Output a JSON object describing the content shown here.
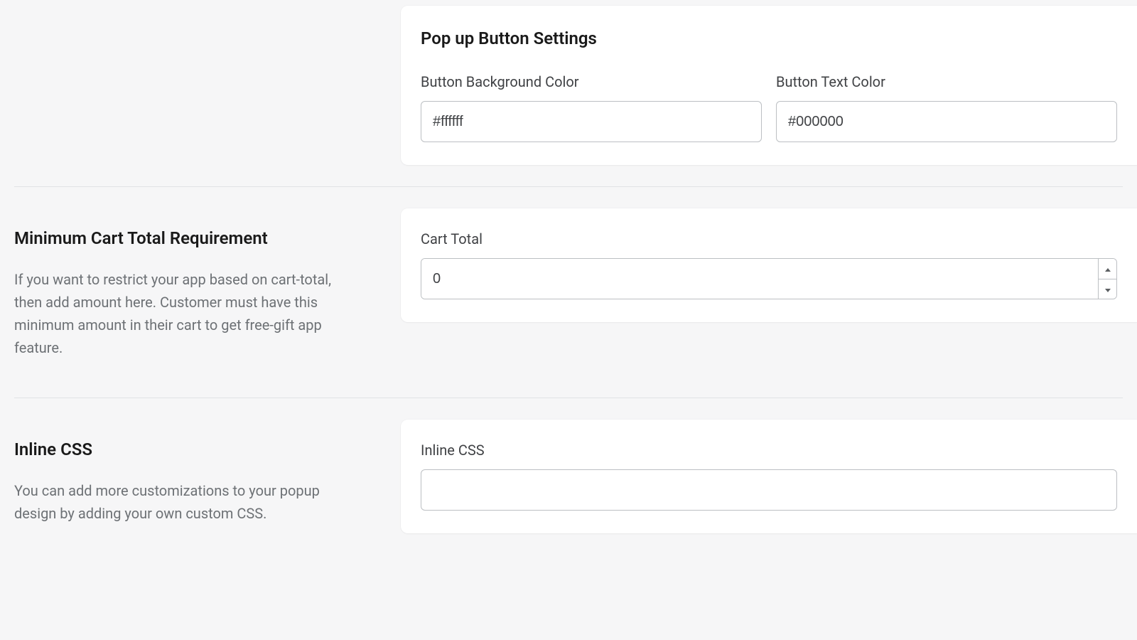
{
  "popup_button": {
    "title": "Pop up Button Settings",
    "bg_label": "Button Background Color",
    "bg_value": "#ffffff",
    "text_label": "Button Text Color",
    "text_value": "#000000"
  },
  "min_cart": {
    "title": "Minimum Cart Total Requirement",
    "description": "If you want to restrict your app based on cart-total, then add amount here. Customer must have this minimum amount in their cart to get free-gift app feature.",
    "cart_total_label": "Cart Total",
    "cart_total_value": "0"
  },
  "inline_css": {
    "title": "Inline CSS",
    "description": "You can add more customizations to your popup design by adding your own custom CSS.",
    "label": "Inline CSS",
    "value": ""
  }
}
